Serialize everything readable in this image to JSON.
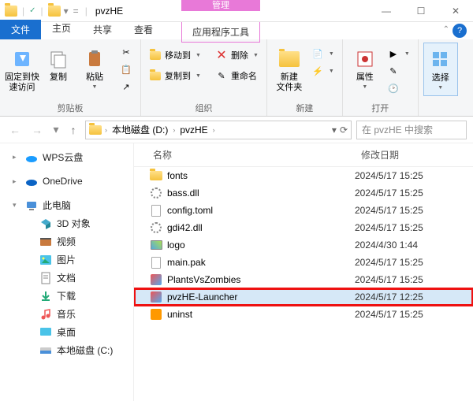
{
  "titlebar": {
    "title": "pvzHE",
    "manage": "管理"
  },
  "tabs": {
    "file": "文件",
    "home": "主页",
    "share": "共享",
    "view": "查看",
    "tools": "应用程序工具"
  },
  "ribbon": {
    "clipboard": {
      "pin": "固定到快\n速访问",
      "copy": "复制",
      "paste": "粘贴",
      "label": "剪贴板"
    },
    "organize": {
      "moveTo": "移动到",
      "copyTo": "复制到",
      "delete": "删除",
      "rename": "重命名",
      "label": "组织"
    },
    "new": {
      "newFolder": "新建\n文件夹",
      "label": "新建"
    },
    "open": {
      "props": "属性",
      "label": "打开"
    },
    "select": {
      "select": "选择",
      "label": ""
    }
  },
  "addressbar": {
    "root": "本地磁盘 (D:)",
    "folder": "pvzHE",
    "searchPlaceholder": "在 pvzHE 中搜索"
  },
  "sidebar": {
    "items": [
      {
        "label": "WPS云盘",
        "icon": "cloud-wps",
        "color": "#1a9cff"
      },
      {
        "label": "OneDrive",
        "icon": "cloud-od",
        "color": "#0b63c4"
      },
      {
        "label": "此电脑",
        "icon": "pc",
        "color": "#1a6fcf",
        "expanded": true
      },
      {
        "label": "3D 对象",
        "icon": "3d",
        "sub": true
      },
      {
        "label": "视频",
        "icon": "video",
        "sub": true
      },
      {
        "label": "图片",
        "icon": "pic",
        "sub": true
      },
      {
        "label": "文档",
        "icon": "doc",
        "sub": true
      },
      {
        "label": "下载",
        "icon": "dl",
        "sub": true
      },
      {
        "label": "音乐",
        "icon": "music",
        "sub": true
      },
      {
        "label": "桌面",
        "icon": "desk",
        "sub": true
      },
      {
        "label": "本地磁盘 (C:)",
        "icon": "drive",
        "sub": true
      }
    ]
  },
  "filelist": {
    "cols": {
      "name": "名称",
      "date": "修改日期"
    },
    "rows": [
      {
        "name": "fonts",
        "date": "2024/5/17 15:25",
        "type": "folder"
      },
      {
        "name": "bass.dll",
        "date": "2024/5/17 15:25",
        "type": "gear"
      },
      {
        "name": "config.toml",
        "date": "2024/5/17 15:25",
        "type": "file"
      },
      {
        "name": "gdi42.dll",
        "date": "2024/5/17 15:25",
        "type": "gear"
      },
      {
        "name": "logo",
        "date": "2024/4/30 1:44",
        "type": "img"
      },
      {
        "name": "main.pak",
        "date": "2024/5/17 15:25",
        "type": "file"
      },
      {
        "name": "PlantsVsZombies",
        "date": "2024/5/17 15:25",
        "type": "app"
      },
      {
        "name": "pvzHE-Launcher",
        "date": "2024/5/17 12:25",
        "type": "app",
        "selected": true,
        "highlight": true
      },
      {
        "name": "uninst",
        "date": "2024/5/17 15:25",
        "type": "box"
      }
    ]
  }
}
